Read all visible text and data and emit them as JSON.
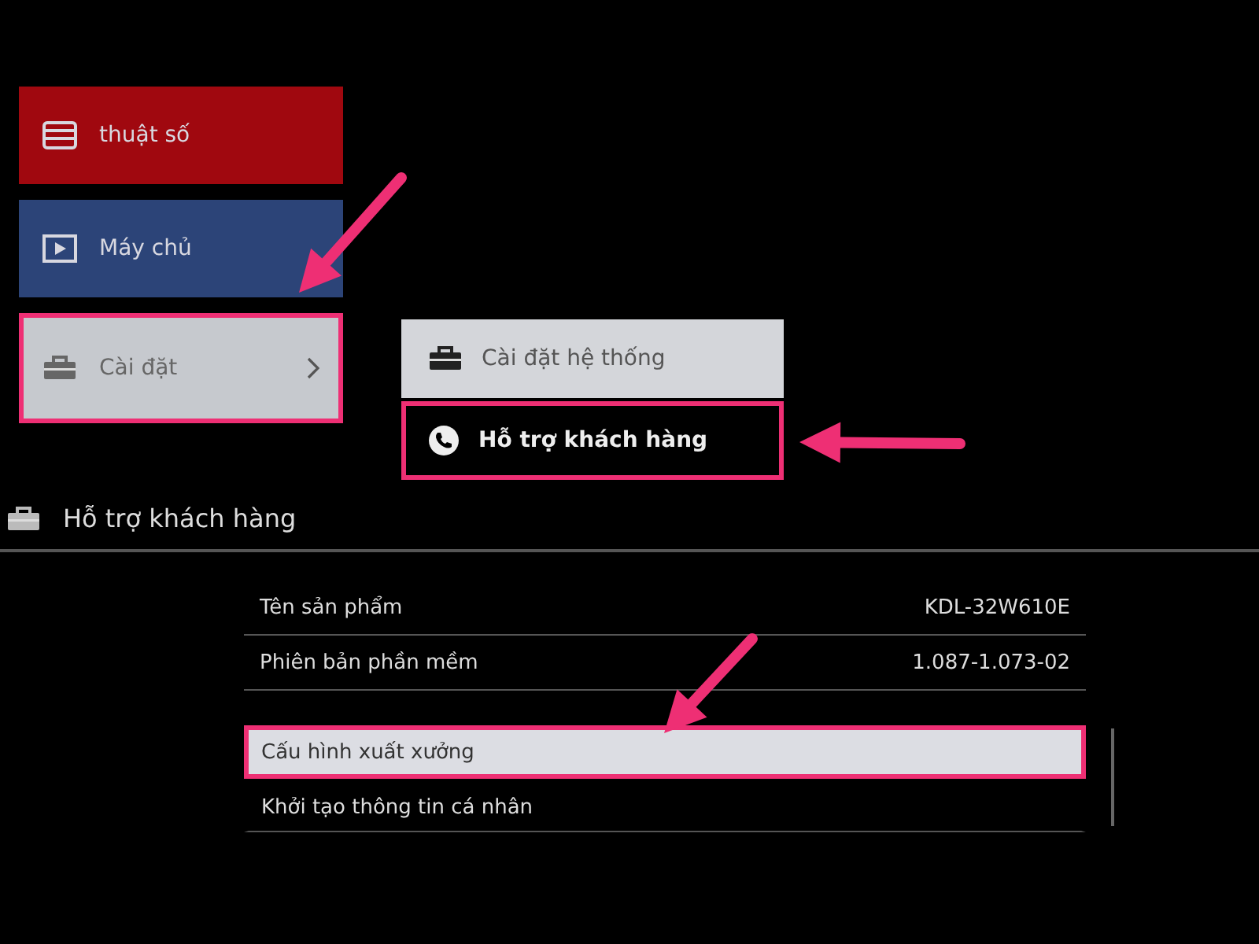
{
  "main_menu": [
    {
      "kind": "tv",
      "label": "thuật số",
      "has_submenu": false,
      "selected": false
    },
    {
      "kind": "media",
      "label": "Máy chủ",
      "has_submenu": false,
      "selected": false
    },
    {
      "kind": "settings",
      "label": "Cài đặt",
      "has_submenu": true,
      "selected": true
    }
  ],
  "submenu": [
    {
      "kind": "toolbox",
      "label": "Cài đặt hệ thống",
      "selected": false
    },
    {
      "kind": "phone",
      "label": "Hỗ trợ khách hàng",
      "selected": true
    }
  ],
  "panel": {
    "title": "Hỗ trợ khách hàng",
    "info_rows": [
      {
        "label": "Tên sản phẩm",
        "value": "KDL-32W610E"
      },
      {
        "label": "Phiên bản phần mềm",
        "value": "1.087-1.073-02"
      }
    ],
    "actions": [
      {
        "label": "Cấu hình xuất xưởng",
        "selected": true
      },
      {
        "label": "Khởi tạo thông tin cá nhân",
        "selected": false
      }
    ]
  }
}
